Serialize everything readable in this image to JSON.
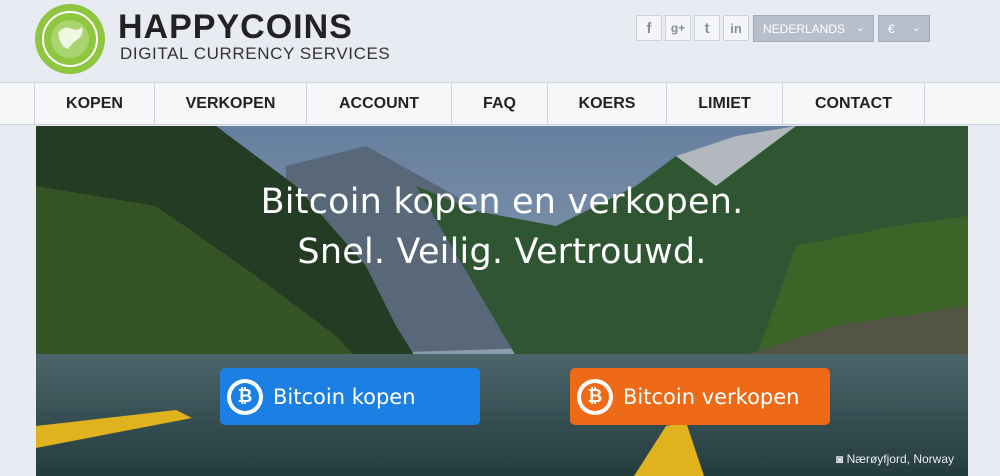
{
  "logo": {
    "title": "HAPPYCOINS",
    "subtitle": "DIGITAL CURRENCY SERVICES",
    "badge_text": "DIGITAL CURRENCY SERVICES"
  },
  "social": [
    {
      "name": "facebook-icon",
      "glyph": "f"
    },
    {
      "name": "google-plus-icon",
      "glyph": "g+"
    },
    {
      "name": "twitter-icon",
      "glyph": "t"
    },
    {
      "name": "linkedin-icon",
      "glyph": "in"
    }
  ],
  "language": {
    "selected": "NEDERLANDS"
  },
  "currency": {
    "selected": "€"
  },
  "nav": [
    {
      "label": "KOPEN"
    },
    {
      "label": "VERKOPEN"
    },
    {
      "label": "ACCOUNT"
    },
    {
      "label": "FAQ"
    },
    {
      "label": "KOERS"
    },
    {
      "label": "LIMIET"
    },
    {
      "label": "CONTACT"
    }
  ],
  "hero": {
    "line1": "Bitcoin kopen en verkopen.",
    "line2": "Snel. Veilig. Vertrouwd.",
    "buy_label": "Bitcoin kopen",
    "sell_label": "Bitcoin verkopen",
    "coin_symbol": "₿",
    "photo_caption": "Nærøyfjord, Norway"
  },
  "colors": {
    "buy": "#1b7fe3",
    "sell": "#ee6a17",
    "logo_green": "#8ec63f"
  }
}
